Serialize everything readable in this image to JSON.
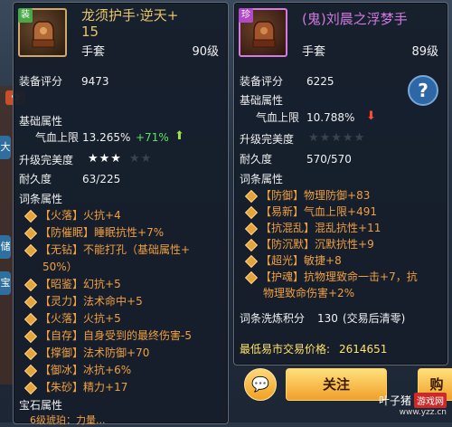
{
  "left": {
    "badge": "装",
    "name_line1": "龙须护手·逆天+",
    "name_line2": "15",
    "type": "手套",
    "level": "90级",
    "score_label": "装备评分",
    "score": "9473",
    "base_label": "基础属性",
    "base_stat_name": "气血上限",
    "base_stat_value": "13.265%",
    "base_stat_bonus": "+71%",
    "perfection_label": "升级完美度",
    "stars_on": "★★★",
    "stars_off": "★★",
    "durability_label": "耐久度",
    "durability": "63/225",
    "affix_label": "词条属性",
    "affixes": [
      {
        "tag": "【火落】",
        "text": "火抗+4"
      },
      {
        "tag": "【防催眠】",
        "text": "睡眠抗性+7%"
      },
      {
        "tag": "【无钻】",
        "text": "不能打孔（基础属性+"
      },
      {
        "tag": "",
        "text": "50%）"
      },
      {
        "tag": "【昭鉴】",
        "text": "幻抗+5"
      },
      {
        "tag": "【灵力】",
        "text": "法术命中+5"
      },
      {
        "tag": "【火落】",
        "text": "火抗+5"
      },
      {
        "tag": "【自存】",
        "text": "自身受到的最终伤害-5"
      },
      {
        "tag": "【撑御】",
        "text": "法术防御+70"
      },
      {
        "tag": "【御冰】",
        "text": "冰抗+6%"
      },
      {
        "tag": "【朱砂】",
        "text": "精力+17"
      }
    ],
    "gem_label": "宝石属性",
    "gem_partial": "6级琥珀：力量..."
  },
  "right": {
    "badge": "珍",
    "name": "(鬼)刘晨之浮梦手",
    "type": "手套",
    "level": "89级",
    "score_label": "装备评分",
    "score": "6225",
    "base_label": "基础属性",
    "base_stat_name": "气血上限",
    "base_stat_value": "10.788%",
    "perfection_label": "升级完美度",
    "stars": "★★★★★",
    "durability_label": "耐久度",
    "durability": "570/570",
    "affix_label": "词条属性",
    "affixes": [
      {
        "tag": "【防御】",
        "text": "物理防御+83"
      },
      {
        "tag": "【易新】",
        "text": "气血上限+491"
      },
      {
        "tag": "【抗混乱】",
        "text": "混乱抗性+11"
      },
      {
        "tag": "【防沉默】",
        "text": "沉默抗性+9"
      },
      {
        "tag": "【超光】",
        "text": "敏捷+8"
      },
      {
        "tag": "【护魂】",
        "text": "抗物理致命一击+7，抗"
      },
      {
        "tag": "",
        "text": "物理致命伤害+2%"
      }
    ],
    "wash_label": "词条洗炼积分",
    "wash_value": "130",
    "wash_note": "(交易后清零)",
    "market_label": "最低易市交易价格:",
    "market_value": "2614651",
    "follow_btn": "关注",
    "buy_btn": "购",
    "help": "?"
  },
  "watermark": {
    "brand": "叶子猪",
    "logo": "游戏网",
    "url": "www.yzz.cn"
  }
}
